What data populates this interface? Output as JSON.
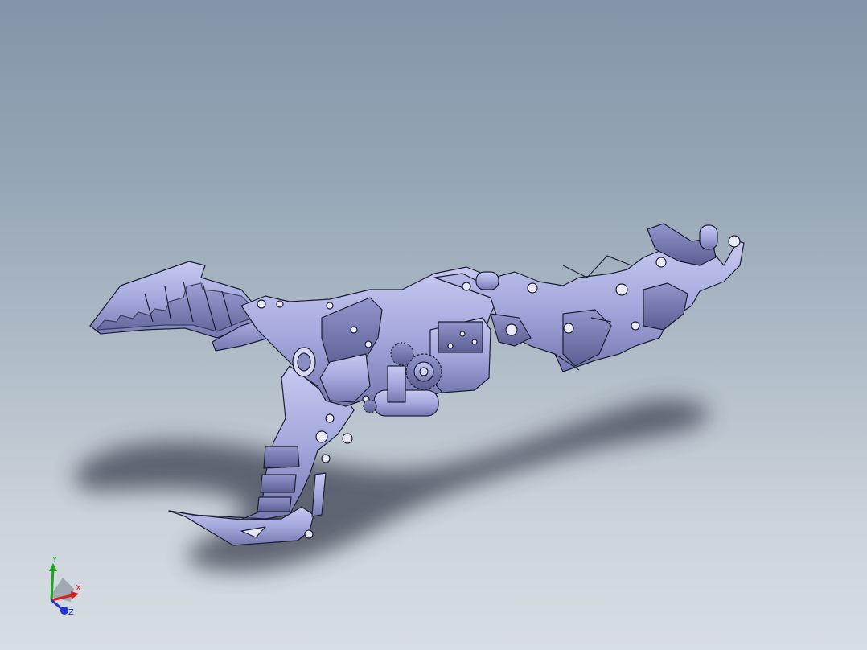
{
  "viewport": {
    "background_top": "#8494a8",
    "background_bottom": "#d6dde3",
    "model_color": "#a8acdf",
    "model_shadow_color": "#3c4250",
    "edge_color": "#1d1f33"
  },
  "model": {
    "name_icon": "robotic-gripper-claw-assembly"
  },
  "triad": {
    "x_label": "X",
    "y_label": "Y",
    "z_label": "Z",
    "x_color": "#d81e1e",
    "y_color": "#1fa51f",
    "z_color": "#2234d4"
  }
}
